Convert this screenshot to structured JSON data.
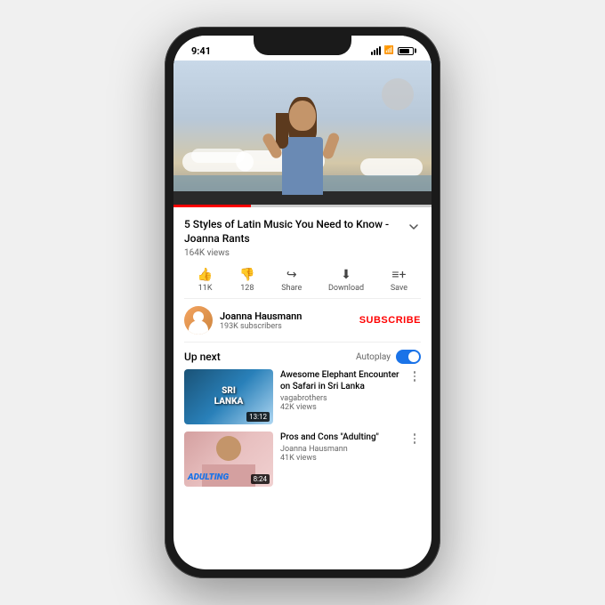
{
  "phone": {
    "status_bar": {
      "time": "9:41"
    },
    "video": {
      "title": "5 Styles of Latin Music You Need to Know - Joanna Rants",
      "views": "164K views",
      "likes": "11K",
      "dislikes": "128",
      "share_label": "Share",
      "download_label": "Download",
      "save_label": "Save",
      "progress_percent": 30
    },
    "channel": {
      "name": "Joanna Hausmann",
      "subscribers": "193K subscribers",
      "subscribe_label": "SUBSCRIBE"
    },
    "up_next": {
      "label": "Up next",
      "autoplay_label": "Autoplay"
    },
    "recommended": [
      {
        "title": "Awesome Elephant Encounter on Safari in Sri Lanka",
        "channel": "vagabrothers",
        "views": "42K views",
        "duration": "13:12",
        "thumb_text": "SRI LANKA"
      },
      {
        "title": "Pros and Cons \"Adulting\"",
        "channel": "Joanna Hausmann",
        "views": "41K views",
        "duration": "8:24",
        "thumb_text": "ADULTING"
      }
    ]
  }
}
